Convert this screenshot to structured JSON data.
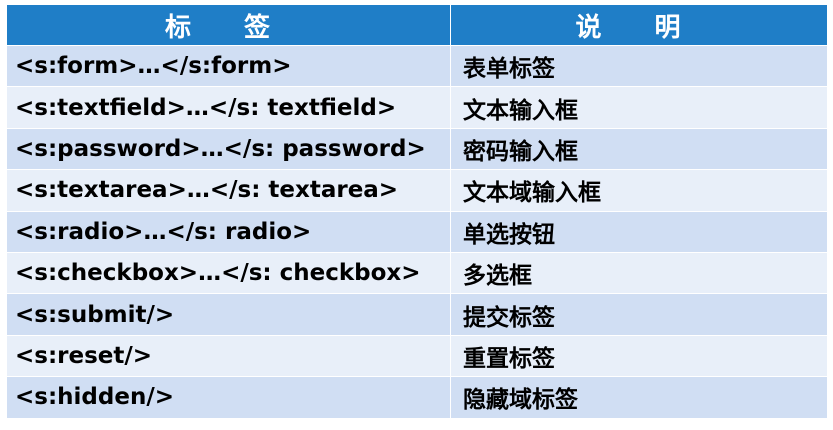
{
  "header": {
    "col1": "标 签",
    "col2": "说 明"
  },
  "rows": [
    {
      "tag": "<s:form>…</s:form>",
      "desc": "表单标签"
    },
    {
      "tag": "<s:textfield>…</s: textfield>",
      "desc": "文本输入框"
    },
    {
      "tag": "<s:password>…</s: password>",
      "desc": "密码输入框"
    },
    {
      "tag": "<s:textarea>…</s: textarea>",
      "desc": "文本域输入框"
    },
    {
      "tag": "<s:radio>…</s: radio>",
      "desc": "单选按钮"
    },
    {
      "tag": "<s:checkbox>…</s: checkbox>",
      "desc": "多选框"
    },
    {
      "tag": "<s:submit/>",
      "desc": "提交标签"
    },
    {
      "tag": "<s:reset/>",
      "desc": "重置标签"
    },
    {
      "tag": "<s:hidden/>",
      "desc": "隐藏域标签"
    }
  ],
  "colors": {
    "header_bg": "#1f7ec7",
    "row_odd": "#d0def3",
    "row_even": "#e8eff9"
  }
}
